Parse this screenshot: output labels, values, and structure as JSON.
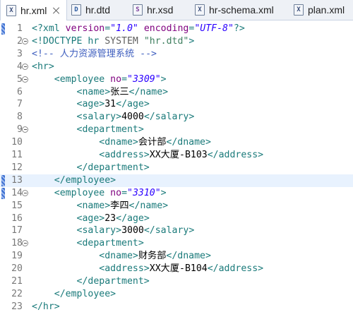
{
  "tabs": [
    {
      "name": "hr.xml",
      "icon": "xml-file-icon",
      "active": true
    },
    {
      "name": "hr.dtd",
      "icon": "dtd-file-icon",
      "active": false
    },
    {
      "name": "hr.xsd",
      "icon": "xsd-file-icon",
      "active": false
    },
    {
      "name": "hr-schema.xml",
      "icon": "xml-file-icon",
      "active": false
    },
    {
      "name": "plan.xml",
      "icon": "xml-file-icon",
      "active": false
    }
  ],
  "editor": {
    "highlighted_line": 13,
    "lines": [
      {
        "n": "1",
        "fold": false,
        "tokens": [
          [
            "t-decl",
            "<?xml "
          ],
          [
            "t-attr",
            "version"
          ],
          [
            "t-decl",
            "="
          ],
          [
            "t-val",
            "\"1.0\""
          ],
          [
            "t-decl",
            " "
          ],
          [
            "t-attr",
            "encoding"
          ],
          [
            "t-decl",
            "="
          ],
          [
            "t-val",
            "\"UTF-8\""
          ],
          [
            "t-decl",
            "?>"
          ]
        ]
      },
      {
        "n": "2",
        "fold": true,
        "tokens": [
          [
            "t-doctype",
            "<!DOCTYPE "
          ],
          [
            "t-doctype",
            "hr "
          ],
          [
            "t-sys",
            "SYSTEM "
          ],
          [
            "t-str",
            "\"hr.dtd\""
          ],
          [
            "t-doctype",
            ">"
          ]
        ]
      },
      {
        "n": "3",
        "fold": false,
        "tokens": [
          [
            "t-comment",
            "<!-- 人力资源管理系统 -->"
          ]
        ]
      },
      {
        "n": "4",
        "fold": true,
        "tokens": [
          [
            "t-tag",
            "<hr>"
          ]
        ]
      },
      {
        "n": "5",
        "fold": true,
        "tokens": [
          [
            "t-text",
            "    "
          ],
          [
            "t-tag",
            "<employee "
          ],
          [
            "t-attr",
            "no"
          ],
          [
            "t-tag",
            "="
          ],
          [
            "t-val",
            "\"3309\""
          ],
          [
            "t-tag",
            ">"
          ]
        ]
      },
      {
        "n": "6",
        "fold": false,
        "tokens": [
          [
            "t-text",
            "        "
          ],
          [
            "t-tag",
            "<name>"
          ],
          [
            "t-text",
            "张三"
          ],
          [
            "t-tag",
            "</name>"
          ]
        ]
      },
      {
        "n": "7",
        "fold": false,
        "tokens": [
          [
            "t-text",
            "        "
          ],
          [
            "t-tag",
            "<age>"
          ],
          [
            "t-text",
            "31"
          ],
          [
            "t-tag",
            "</age>"
          ]
        ]
      },
      {
        "n": "8",
        "fold": false,
        "tokens": [
          [
            "t-text",
            "        "
          ],
          [
            "t-tag",
            "<salary>"
          ],
          [
            "t-text",
            "4000"
          ],
          [
            "t-tag",
            "</salary>"
          ]
        ]
      },
      {
        "n": "9",
        "fold": true,
        "tokens": [
          [
            "t-text",
            "        "
          ],
          [
            "t-tag",
            "<department>"
          ]
        ]
      },
      {
        "n": "10",
        "fold": false,
        "tokens": [
          [
            "t-text",
            "            "
          ],
          [
            "t-tag",
            "<dname>"
          ],
          [
            "t-text",
            "会计部"
          ],
          [
            "t-tag",
            "</dname>"
          ]
        ]
      },
      {
        "n": "11",
        "fold": false,
        "tokens": [
          [
            "t-text",
            "            "
          ],
          [
            "t-tag",
            "<address>"
          ],
          [
            "t-text",
            "XX大厦-B103"
          ],
          [
            "t-tag",
            "</address>"
          ]
        ]
      },
      {
        "n": "12",
        "fold": false,
        "tokens": [
          [
            "t-text",
            "        "
          ],
          [
            "t-tag",
            "</department>"
          ]
        ]
      },
      {
        "n": "13",
        "fold": false,
        "tokens": [
          [
            "t-text",
            "    "
          ],
          [
            "t-tag",
            "</employee>"
          ]
        ]
      },
      {
        "n": "14",
        "fold": true,
        "tokens": [
          [
            "t-text",
            "    "
          ],
          [
            "t-tag",
            "<employee "
          ],
          [
            "t-attr",
            "no"
          ],
          [
            "t-tag",
            "="
          ],
          [
            "t-val",
            "\"3310\""
          ],
          [
            "t-tag",
            ">"
          ]
        ]
      },
      {
        "n": "15",
        "fold": false,
        "tokens": [
          [
            "t-text",
            "        "
          ],
          [
            "t-tag",
            "<name>"
          ],
          [
            "t-text",
            "李四"
          ],
          [
            "t-tag",
            "</name>"
          ]
        ]
      },
      {
        "n": "16",
        "fold": false,
        "tokens": [
          [
            "t-text",
            "        "
          ],
          [
            "t-tag",
            "<age>"
          ],
          [
            "t-text",
            "23"
          ],
          [
            "t-tag",
            "</age>"
          ]
        ]
      },
      {
        "n": "17",
        "fold": false,
        "tokens": [
          [
            "t-text",
            "        "
          ],
          [
            "t-tag",
            "<salary>"
          ],
          [
            "t-text",
            "3000"
          ],
          [
            "t-tag",
            "</salary>"
          ]
        ]
      },
      {
        "n": "18",
        "fold": true,
        "tokens": [
          [
            "t-text",
            "        "
          ],
          [
            "t-tag",
            "<department>"
          ]
        ]
      },
      {
        "n": "19",
        "fold": false,
        "tokens": [
          [
            "t-text",
            "            "
          ],
          [
            "t-tag",
            "<dname>"
          ],
          [
            "t-text",
            "财务部"
          ],
          [
            "t-tag",
            "</dname>"
          ]
        ]
      },
      {
        "n": "20",
        "fold": false,
        "tokens": [
          [
            "t-text",
            "            "
          ],
          [
            "t-tag",
            "<address>"
          ],
          [
            "t-text",
            "XX大厦-B104"
          ],
          [
            "t-tag",
            "</address>"
          ]
        ]
      },
      {
        "n": "21",
        "fold": false,
        "tokens": [
          [
            "t-text",
            "        "
          ],
          [
            "t-tag",
            "</department>"
          ]
        ]
      },
      {
        "n": "22",
        "fold": false,
        "tokens": [
          [
            "t-text",
            "    "
          ],
          [
            "t-tag",
            "</employee>"
          ]
        ]
      },
      {
        "n": "23",
        "fold": false,
        "tokens": [
          [
            "t-tag",
            "</hr>"
          ]
        ]
      }
    ]
  }
}
